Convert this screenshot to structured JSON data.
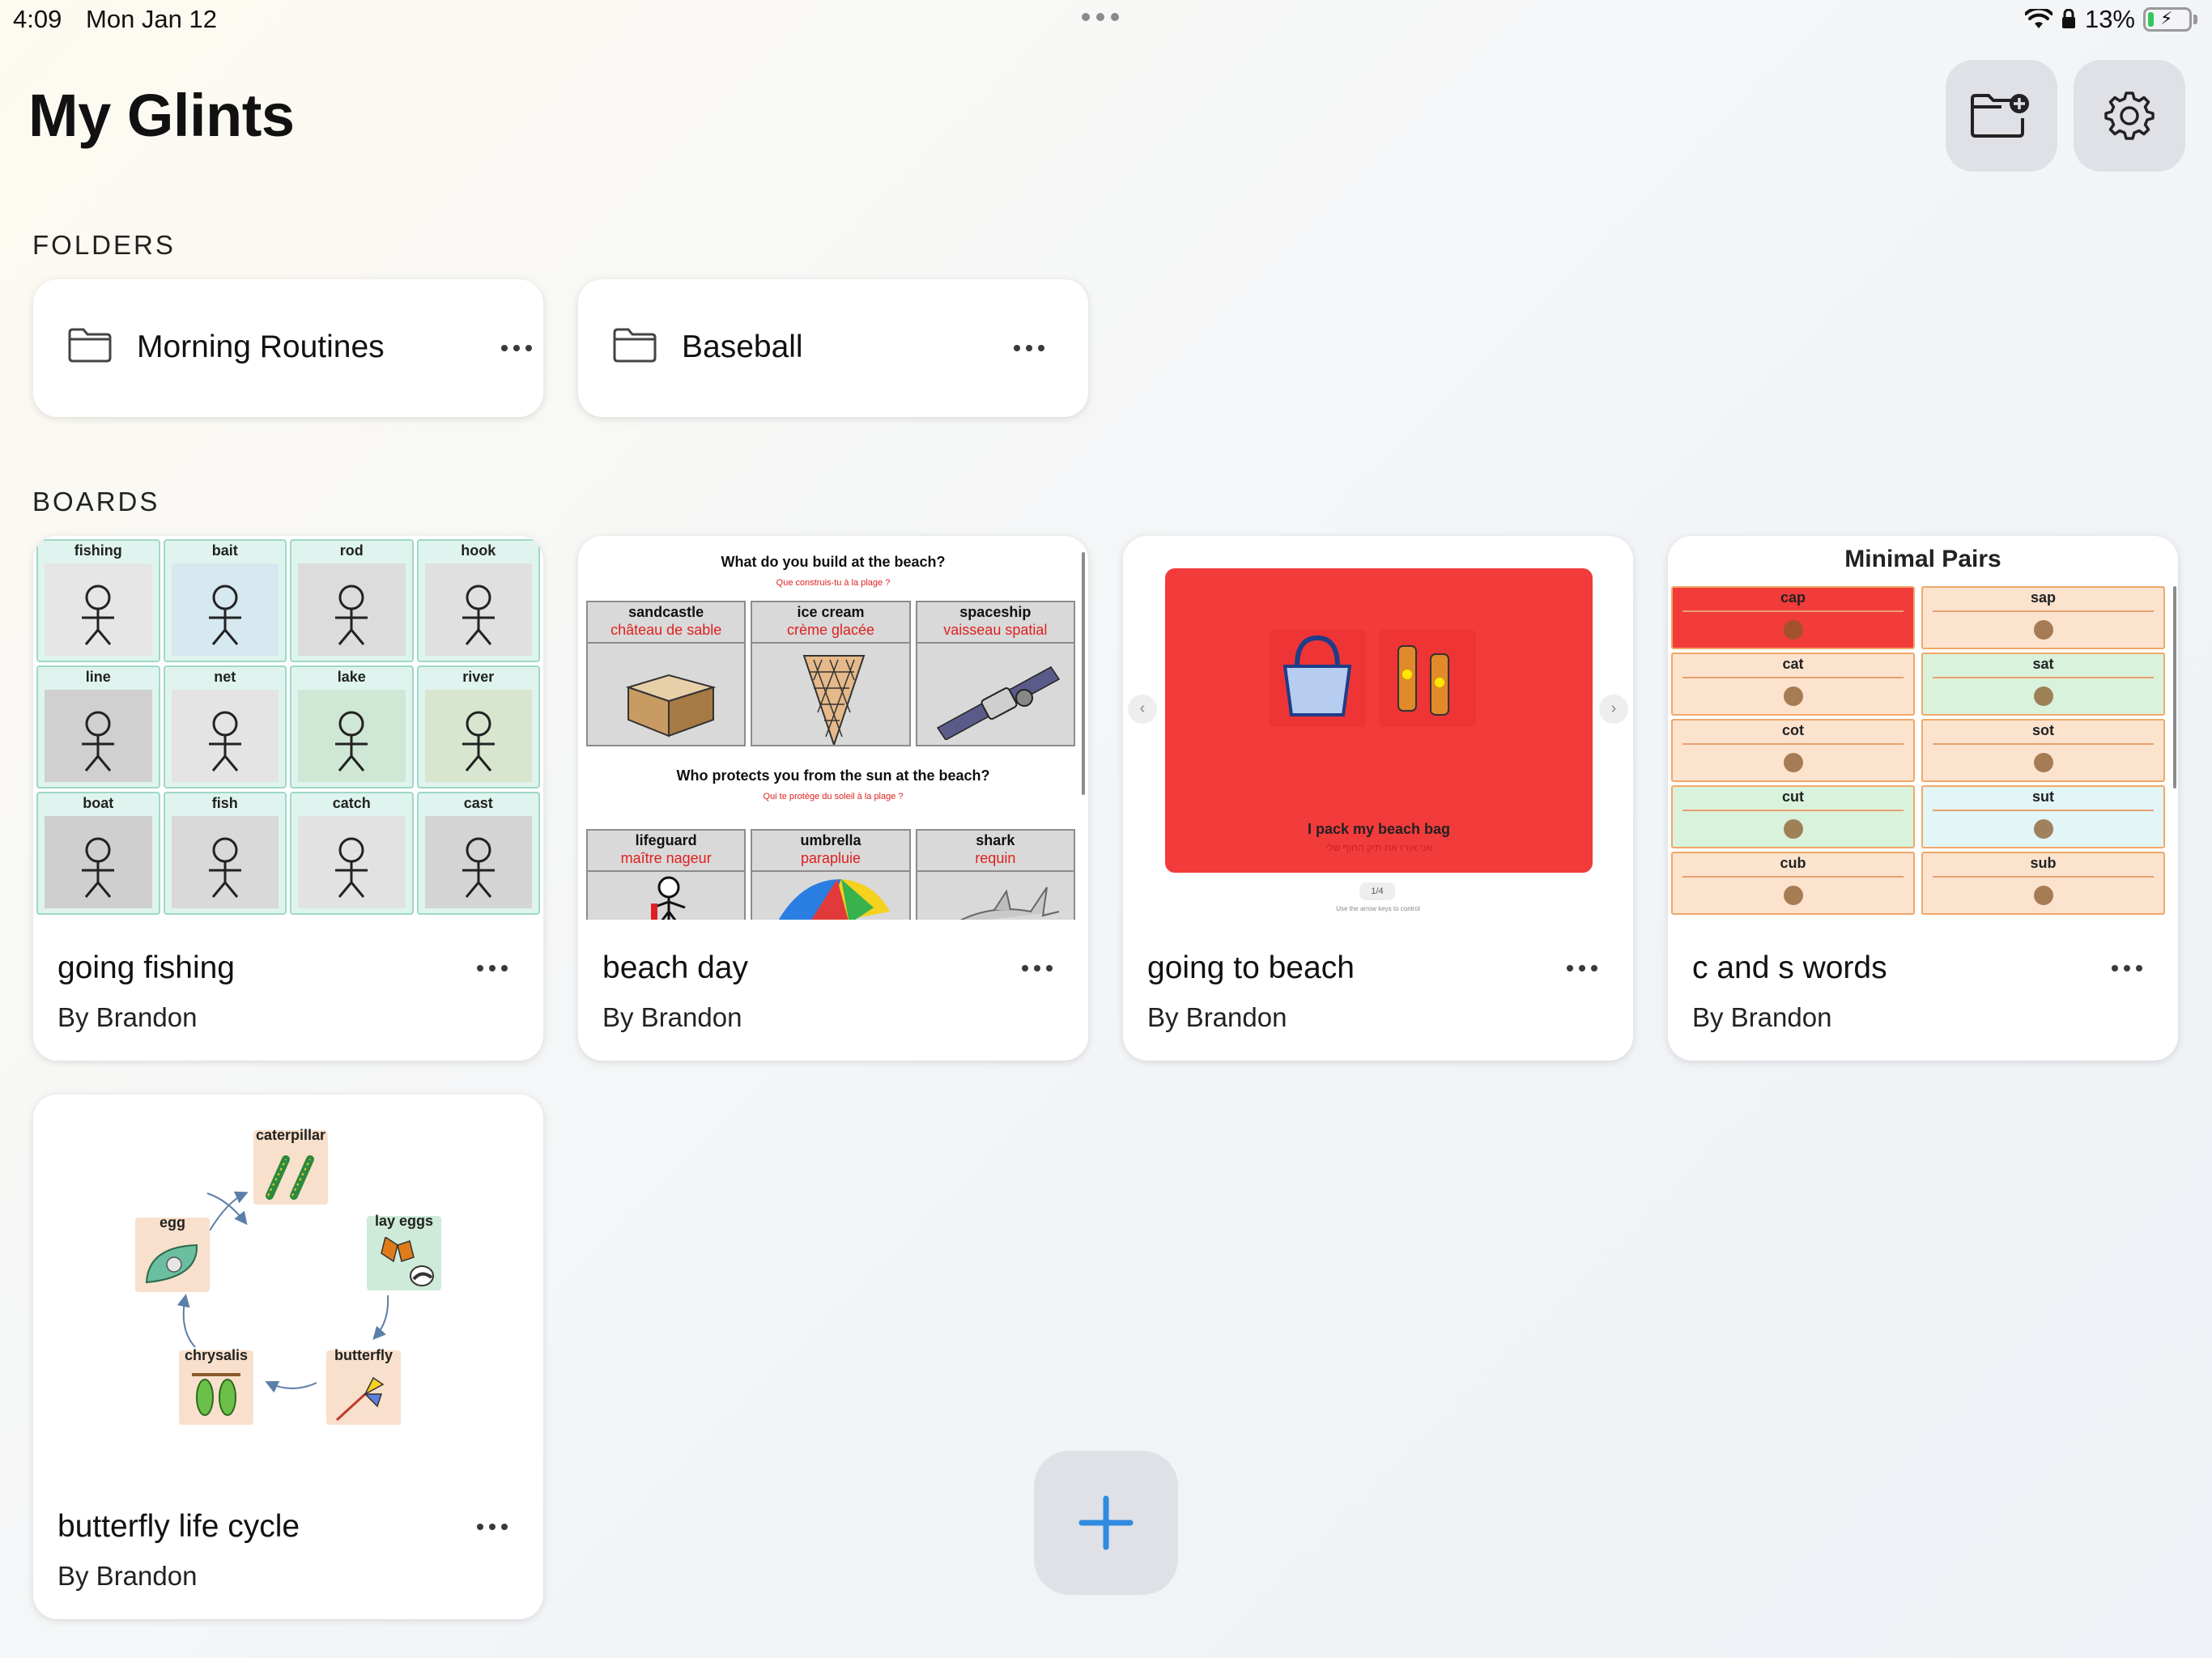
{
  "status_bar": {
    "time": "4:09",
    "date": "Mon Jan 12",
    "battery_percent": "13%",
    "battery_level": 0.13,
    "charging": true
  },
  "header": {
    "title": "My Glints",
    "new_folder_icon": "folder-plus-icon",
    "settings_icon": "gear-icon"
  },
  "folders_section": {
    "label": "FOLDERS",
    "items": [
      {
        "name": "Morning Routines",
        "icon": "folder-icon"
      },
      {
        "name": "Baseball",
        "icon": "folder-icon"
      }
    ]
  },
  "boards_section": {
    "label": "BOARDS",
    "items": [
      {
        "title": "going fishing",
        "author": "By Brandon",
        "thumbnail": {
          "cells": [
            "fishing",
            "bait",
            "rod",
            "hook",
            "line",
            "net",
            "lake",
            "river",
            "boat",
            "fish",
            "catch",
            "cast"
          ]
        }
      },
      {
        "title": "beach day",
        "author": "By Brandon",
        "thumbnail": {
          "question1": "What do you build at the beach?",
          "question1_fr": "Que construis-tu à la plage ?",
          "row1": [
            {
              "en": "sandcastle",
              "fr": "château de sable"
            },
            {
              "en": "ice cream",
              "fr": "crème glacée"
            },
            {
              "en": "spaceship",
              "fr": "vaisseau spatial"
            }
          ],
          "question2": "Who protects you from the sun at the beach?",
          "question2_fr": "Qui te protège du soleil à la plage ?",
          "row2": [
            {
              "en": "lifeguard",
              "fr": "maître nageur"
            },
            {
              "en": "umbrella",
              "fr": "parapluie"
            },
            {
              "en": "shark",
              "fr": "requin"
            }
          ]
        }
      },
      {
        "title": "going to beach",
        "author": "By Brandon",
        "thumbnail": {
          "caption": "I pack my beach bag",
          "caption_he": "אני אורז את תיק החוף שלי",
          "page_indicator": "1/4",
          "hint": "Use the arrow keys to control",
          "bg_color": "#f23b3b"
        }
      },
      {
        "title": "c and s words",
        "author": "By Brandon",
        "thumbnail": {
          "heading": "Minimal Pairs",
          "pairs": [
            {
              "left": "cap",
              "right": "sap",
              "left_color": "#f23b3b",
              "right_color": "#fbe3ce"
            },
            {
              "left": "cat",
              "right": "sat",
              "left_color": "#fbe3ce",
              "right_color": "#d9f2dc"
            },
            {
              "left": "cot",
              "right": "sot",
              "left_color": "#fbe3ce",
              "right_color": "#fbe3ce"
            },
            {
              "left": "cut",
              "right": "sut",
              "left_color": "#d9f2dc",
              "right_color": "#e2f5f7"
            },
            {
              "left": "cub",
              "right": "sub",
              "left_color": "#fbe3ce",
              "right_color": "#fbe3ce"
            }
          ]
        }
      },
      {
        "title": "butterfly life cycle",
        "author": "By Brandon",
        "thumbnail": {
          "stages": [
            "caterpillar",
            "lay eggs",
            "butterfly",
            "chrysalis",
            "egg"
          ]
        }
      }
    ]
  },
  "add_button": {
    "icon": "plus-icon",
    "accent_color": "#2f8be0"
  }
}
